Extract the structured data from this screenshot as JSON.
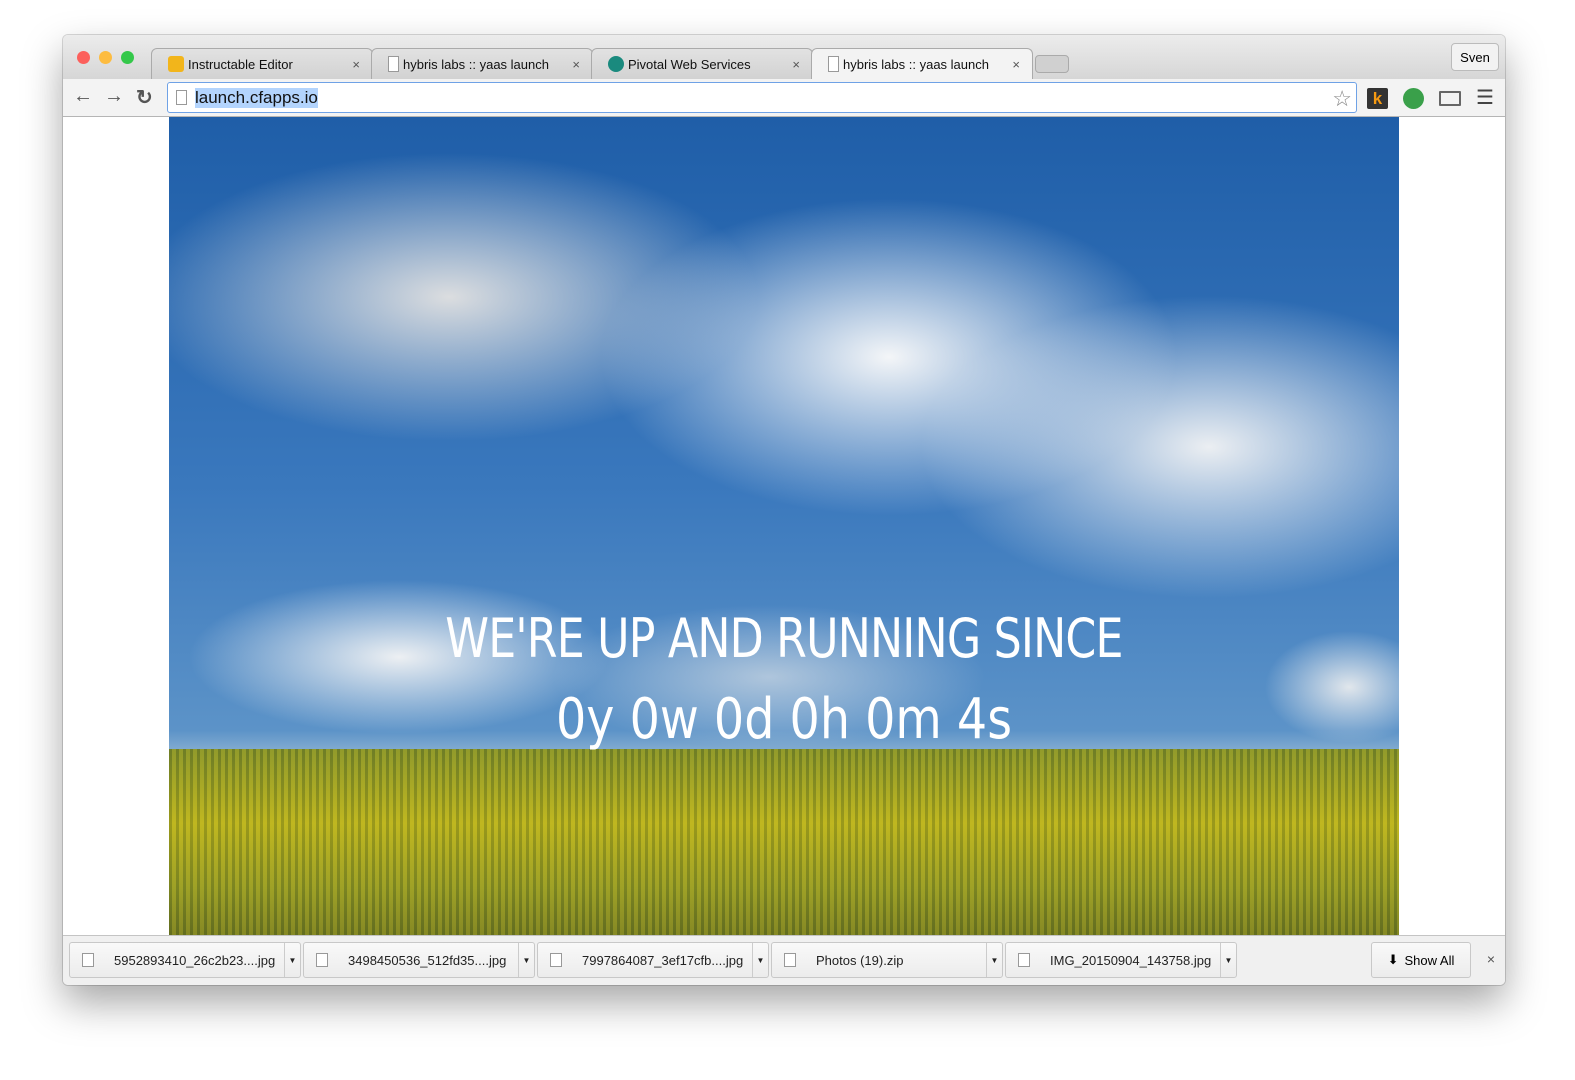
{
  "browser": {
    "tabs": [
      {
        "title": "Instructable Editor",
        "icon": "instructables-robot-icon"
      },
      {
        "title": "hybris labs :: yaas launch",
        "icon": "page-icon"
      },
      {
        "title": "Pivotal Web Services",
        "icon": "pivotal-icon"
      },
      {
        "title": "hybris labs :: yaas launch",
        "icon": "page-icon",
        "active": true
      }
    ],
    "close_glyph": "×",
    "user": "Sven",
    "url": "launch.cfapps.io",
    "colors": {
      "accent": "#6fa2e6",
      "url_highlight": "#b3d4fd"
    }
  },
  "page": {
    "headline": "WE'RE UP AND RUNNING SINCE",
    "uptime": "0y 0w 0d 0h 0m 4s"
  },
  "downloads": {
    "items": [
      {
        "name": "5952893410_26c2b23....jpg"
      },
      {
        "name": "3498450536_512fd35....jpg"
      },
      {
        "name": "7997864087_3ef17cfb....jpg"
      },
      {
        "name": "Photos (19).zip"
      },
      {
        "name": "IMG_20150904_143758.jpg"
      }
    ],
    "show_all": "Show All",
    "close": "×"
  }
}
